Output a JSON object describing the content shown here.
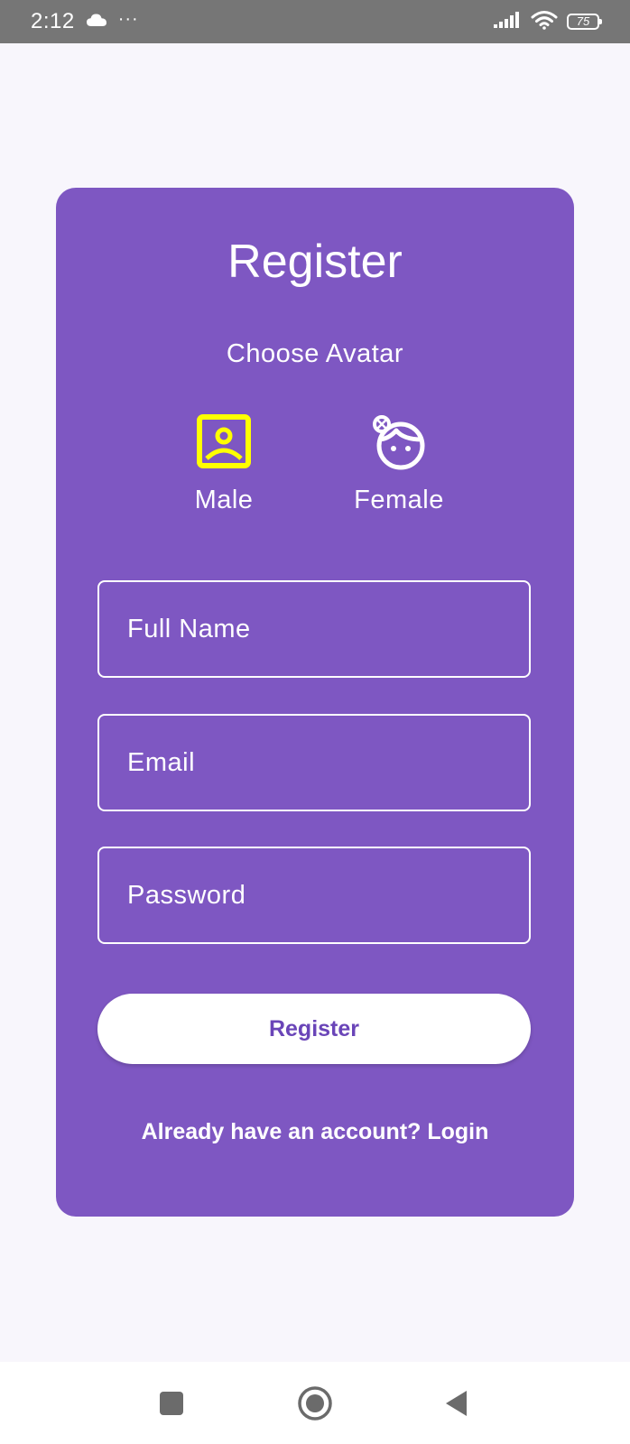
{
  "status_bar": {
    "time": "2:12",
    "overflow": "···",
    "battery": "75",
    "icons": [
      "cloud-icon",
      "signal-icon",
      "wifi-icon",
      "battery-icon"
    ]
  },
  "register_card": {
    "title": "Register",
    "avatar_heading": "Choose Avatar",
    "avatars": [
      {
        "label": "Male",
        "icon": "male-avatar-icon",
        "selected": true,
        "color": "#ffff00"
      },
      {
        "label": "Female",
        "icon": "female-avatar-icon",
        "selected": false,
        "color": "#ffffff"
      }
    ],
    "fields": {
      "full_name": {
        "placeholder": "Full Name",
        "value": ""
      },
      "email": {
        "placeholder": "Email",
        "value": ""
      },
      "password": {
        "placeholder": "Password",
        "value": ""
      }
    },
    "submit_label": "Register",
    "login_prompt": "Already have an account? Login"
  },
  "nav_bar": {
    "buttons": [
      "recents-icon",
      "home-icon",
      "back-icon"
    ]
  },
  "colors": {
    "card": "#7e57c2",
    "background": "#f8f6fc",
    "selected_avatar": "#ffff00",
    "button_text": "#6a45b8",
    "status_bar": "#767676"
  }
}
